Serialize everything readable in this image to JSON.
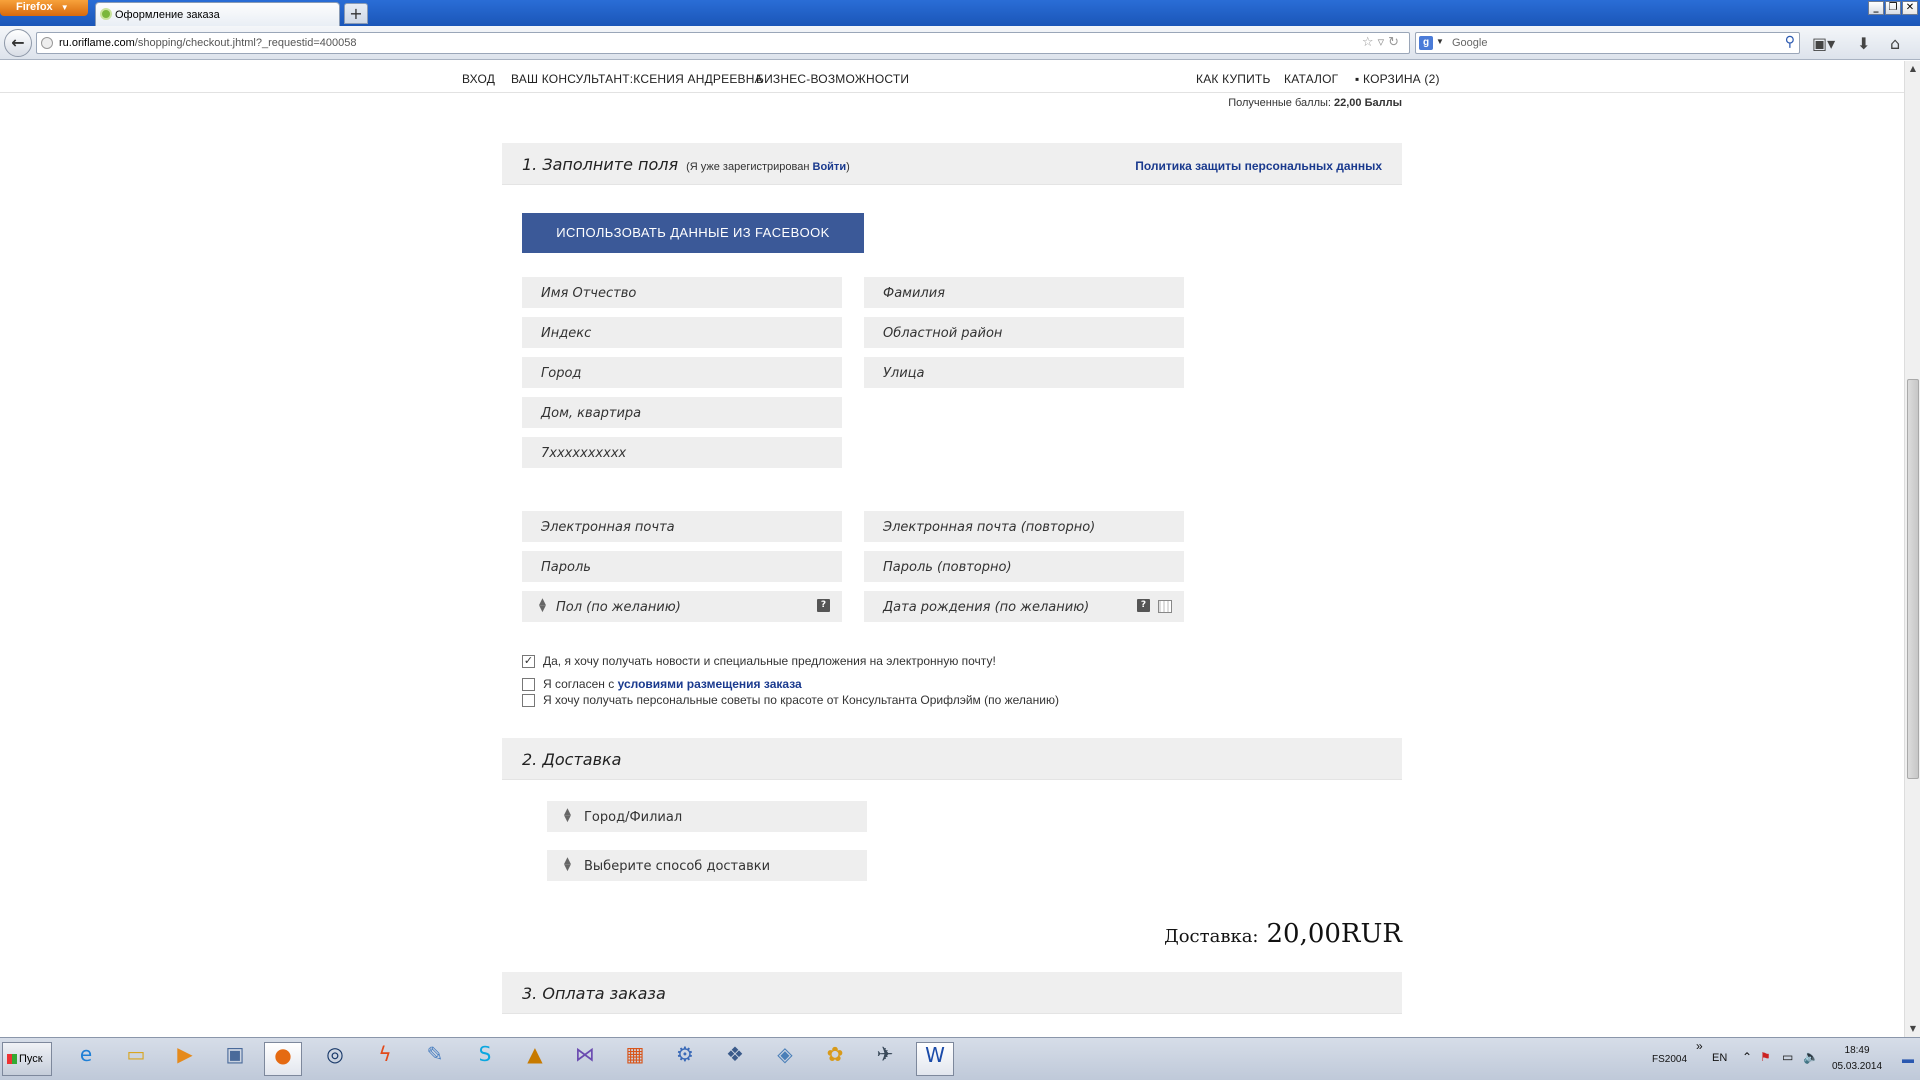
{
  "browser": {
    "menu_button": "Firefox",
    "tab_title": "Оформление заказа",
    "new_tab_symbol": "+",
    "url_host": "ru.oriflame.com",
    "url_path": "/shopping/checkout.jhtml?_requestid=400058",
    "search_engine": "Google",
    "window_controls": [
      "_",
      "❐",
      "✕"
    ]
  },
  "topnav": {
    "login": "ВХОД",
    "consultant": "ВАШ КОНСУЛЬТАНТ:КСЕНИЯ АНДРЕЕВНА",
    "business": "БИЗНЕС-ВОЗМОЖНОСТИ",
    "how_to_buy": "КАК КУПИТЬ",
    "catalog": "КАТАЛОГ",
    "cart": "КОРЗИНА (2)"
  },
  "points": {
    "label": "Полученные баллы:",
    "value": "22,00 Баллы"
  },
  "section1": {
    "title": "1. Заполните поля",
    "already_prefix": "(Я уже зарегистрирован",
    "login_link": "Войти",
    "already_suffix": ")",
    "policy_link": "Политика защиты персональных данных",
    "facebook_button": "ИСПОЛЬЗОВАТЬ ДАННЫЕ ИЗ FACEBOOK",
    "fields": {
      "first_name": "Имя Отчество",
      "last_name": "Фамилия",
      "postcode": "Индекс",
      "region": "Областной район",
      "city": "Город",
      "street": "Улица",
      "house": "Дом, квартира",
      "phone": "7xxxxxxxxxx",
      "email": "Электронная почта",
      "email_repeat": "Электронная почта (повторно)",
      "password": "Пароль",
      "password_repeat": "Пароль (повторно)",
      "gender": "Пол (по желанию)",
      "birthdate": "Дата рождения (по желанию)"
    },
    "help_symbol": "?",
    "checkboxes": {
      "newsletter": "Да, я хочу получать новости и специальные предложения на электронную почту!",
      "newsletter_checked": true,
      "terms_prefix": "Я согласен с",
      "terms_link": "условиями размещения заказа",
      "terms_checked": false,
      "advice": "Я хочу получать персональные советы по красоте от Консультанта Орифлэйм (по желанию)",
      "advice_checked": false
    }
  },
  "section2": {
    "title": "2. Доставка",
    "city_select": "Город/Филиал",
    "method_select": "Выберите способ доставки",
    "total_label": "Доставка:",
    "total_value": "20,00RUR"
  },
  "section3": {
    "title": "3. Оплата заказа"
  },
  "taskbar": {
    "start_label": "Пуск",
    "tray_label": "FS2004",
    "lang": "EN",
    "time": "18:49",
    "date": "05.03.2014"
  }
}
